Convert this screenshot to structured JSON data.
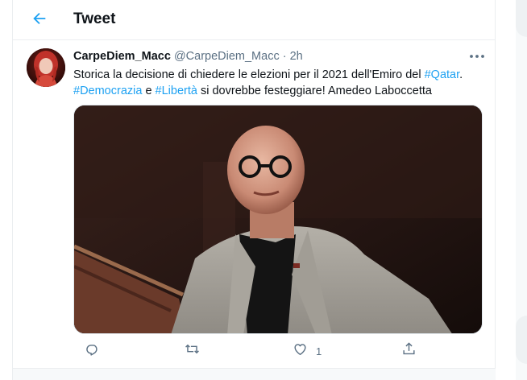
{
  "header": {
    "title": "Tweet",
    "back_icon": "arrow-left-icon"
  },
  "tweet": {
    "display_name": "CarpeDiem_Macc",
    "handle": "@CarpeDiem_Macc",
    "separator": "·",
    "time": "2h",
    "text": {
      "part1": "Storica la decisione di chiedere le elezioni per il 2021 dell'Emiro del ",
      "hashtag1": "#Qatar",
      "part2": ".",
      "hashtag2": "#Democrazia",
      "part3": " e ",
      "hashtag3": "#Libertà",
      "part4": " si dovrebbe festeggiare! Amedeo Laboccetta"
    },
    "actions": {
      "reply_icon": "reply-icon",
      "retweet_icon": "retweet-icon",
      "like_icon": "heart-icon",
      "like_count": "1",
      "share_icon": "share-icon"
    }
  },
  "colors": {
    "accent": "#1da1f2",
    "secondary_text": "#5b7083",
    "border": "#ebeef0"
  }
}
